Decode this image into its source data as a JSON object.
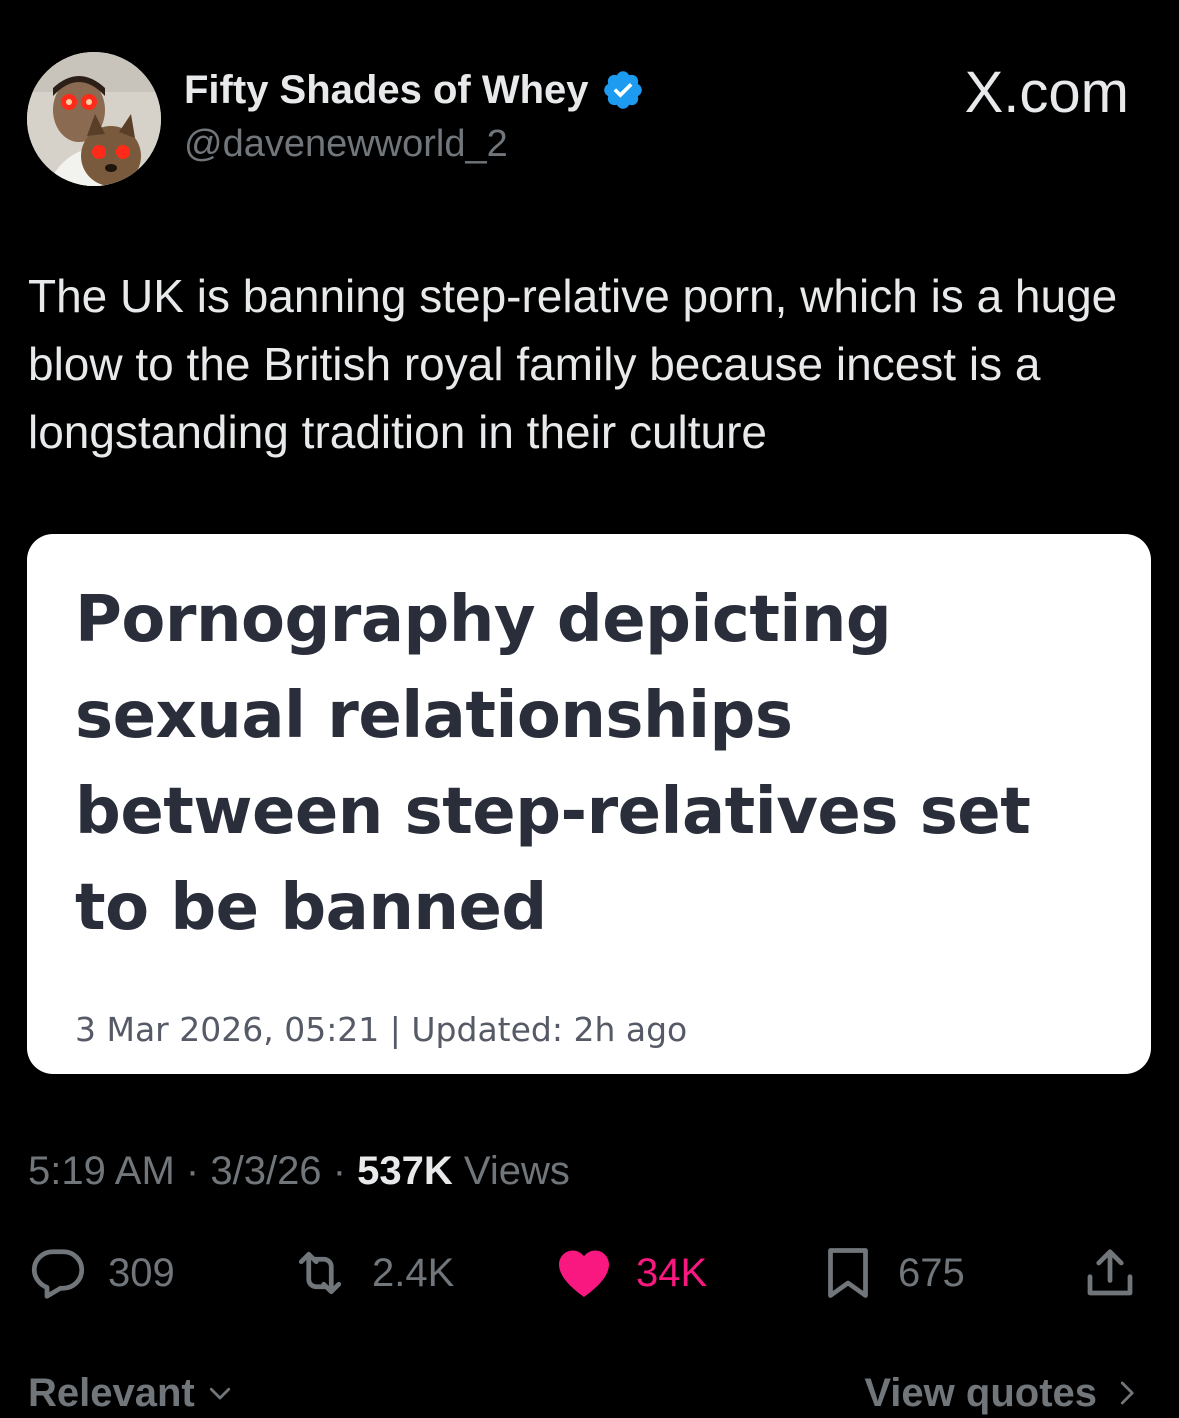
{
  "author": {
    "display_name": "Fifty Shades of Whey",
    "handle": "@davenewworld_2",
    "verified": true,
    "avatar_icon": "avatar-photo"
  },
  "brand": "X.com",
  "tweet": {
    "text": "The UK is banning step-relative porn, which is a huge blow to the British royal family because incest is a longstanding tradition in their culture"
  },
  "article_card": {
    "headline": "Pornography depicting sexual relationships between step-relatives set to be banned",
    "meta": "3 Mar 2026, 05:21 | Updated: 2h ago"
  },
  "meta": {
    "time": "5:19 AM",
    "date": "3/3/26",
    "views_count": "537K",
    "views_label": "Views",
    "separator": "·"
  },
  "actions": {
    "replies": "309",
    "reposts": "2.4K",
    "likes": "34K",
    "bookmarks": "675",
    "icons": [
      "reply-icon",
      "repost-icon",
      "heart-icon",
      "bookmark-icon",
      "share-icon"
    ]
  },
  "footer": {
    "sort_label": "Relevant",
    "view_quotes": "View quotes"
  },
  "colors": {
    "background": "#000000",
    "text_primary": "#e7e9ea",
    "text_secondary": "#71767b",
    "verified_blue": "#1d9bf0",
    "like_pink": "#f91880",
    "card_bg": "#ffffff",
    "headline_text": "#2a2e3a"
  }
}
